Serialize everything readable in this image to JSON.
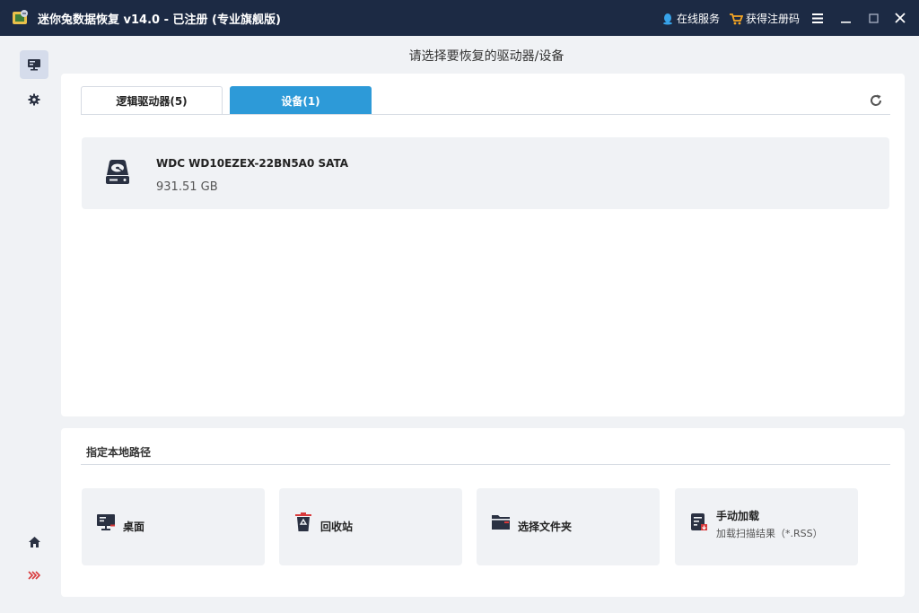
{
  "titlebar": {
    "title": "迷你兔数据恢复 v14.0 - 已注册 (专业旗舰版)",
    "service_label": "在线服务",
    "register_label": "获得注册码"
  },
  "header": {
    "title": "请选择要恢复的驱动器/设备"
  },
  "tabs": {
    "logical_label": "逻辑驱动器(5)",
    "devices_label": "设备(1)",
    "active": "devices"
  },
  "devices": [
    {
      "name": "WDC WD10EZEX-22BN5A0 SATA",
      "size": "931.51 GB"
    }
  ],
  "local_paths": {
    "title": "指定本地路径",
    "items": [
      {
        "label": "桌面"
      },
      {
        "label": "回收站"
      },
      {
        "label": "选择文件夹"
      },
      {
        "label": "手动加载",
        "sub": "加载扫描结果（*.RSS）"
      }
    ]
  },
  "colors": {
    "titlebar_bg": "#1c2a44",
    "accent": "#2d9ad8",
    "icon_dark": "#2a3142"
  }
}
